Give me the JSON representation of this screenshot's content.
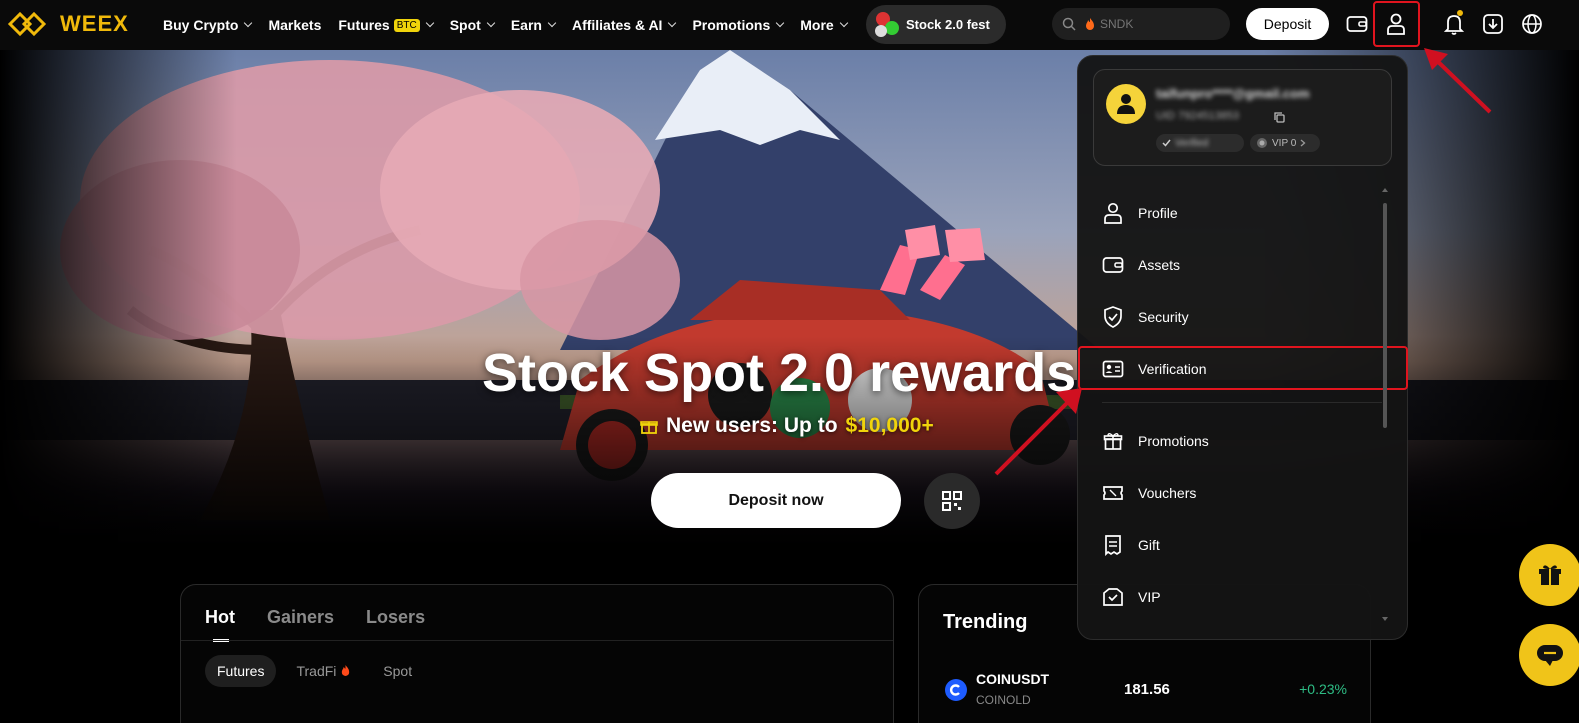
{
  "brand": {
    "name": "WEEX",
    "color": "#f0b90b"
  },
  "nav": {
    "items": [
      {
        "label": "Buy Crypto",
        "dropdown": true
      },
      {
        "label": "Markets",
        "dropdown": false
      },
      {
        "label": "Futures",
        "tag": "BTC",
        "dropdown": true
      },
      {
        "label": "Spot",
        "dropdown": true
      },
      {
        "label": "Earn",
        "dropdown": true
      },
      {
        "label": "Affiliates & AI",
        "dropdown": true
      },
      {
        "label": "Promotions",
        "dropdown": true
      },
      {
        "label": "More",
        "dropdown": true
      }
    ],
    "fest_label": "Stock 2.0 fest",
    "search_placeholder": "SNDK",
    "deposit_label": "Deposit",
    "icons": [
      "wallet-icon",
      "user-icon",
      "bell-icon",
      "download-icon",
      "globe-icon"
    ]
  },
  "hero": {
    "title": "Stock Spot 2.0 rewards",
    "subtitle_prefix": "New users: Up to",
    "subtitle_amount": "$10,000+",
    "cta_label": "Deposit now"
  },
  "markets": {
    "tabs": [
      "Hot",
      "Gainers",
      "Losers"
    ],
    "active_tab": "Hot",
    "subtabs": [
      "Futures",
      "TradFi",
      "Spot"
    ],
    "active_subtab": "Futures"
  },
  "trending": {
    "title": "Trending",
    "rows": [
      {
        "symbol": "COINUSDT",
        "sub": "COINOLD",
        "price": "181.56",
        "change": "+0.23%"
      }
    ]
  },
  "user_menu": {
    "email": "taifunpro****@gmail.com",
    "uid": "UID 7924513853",
    "verified_label": "Verified",
    "vip_label": "VIP 0",
    "items": [
      {
        "label": "Profile",
        "icon": "user-icon"
      },
      {
        "label": "Assets",
        "icon": "wallet-icon"
      },
      {
        "label": "Security",
        "icon": "shield-icon"
      },
      {
        "label": "Verification",
        "icon": "id-card-icon"
      },
      {
        "label": "Promotions",
        "icon": "gift-box-icon"
      },
      {
        "label": "Vouchers",
        "icon": "voucher-icon"
      },
      {
        "label": "Gift",
        "icon": "gift-icon"
      },
      {
        "label": "VIP",
        "icon": "vip-icon"
      }
    ]
  },
  "colors": {
    "accent": "#f0b90b",
    "highlight": "#e0141e",
    "positive": "#2ebd85",
    "btc_tag": "#f0d40b"
  }
}
